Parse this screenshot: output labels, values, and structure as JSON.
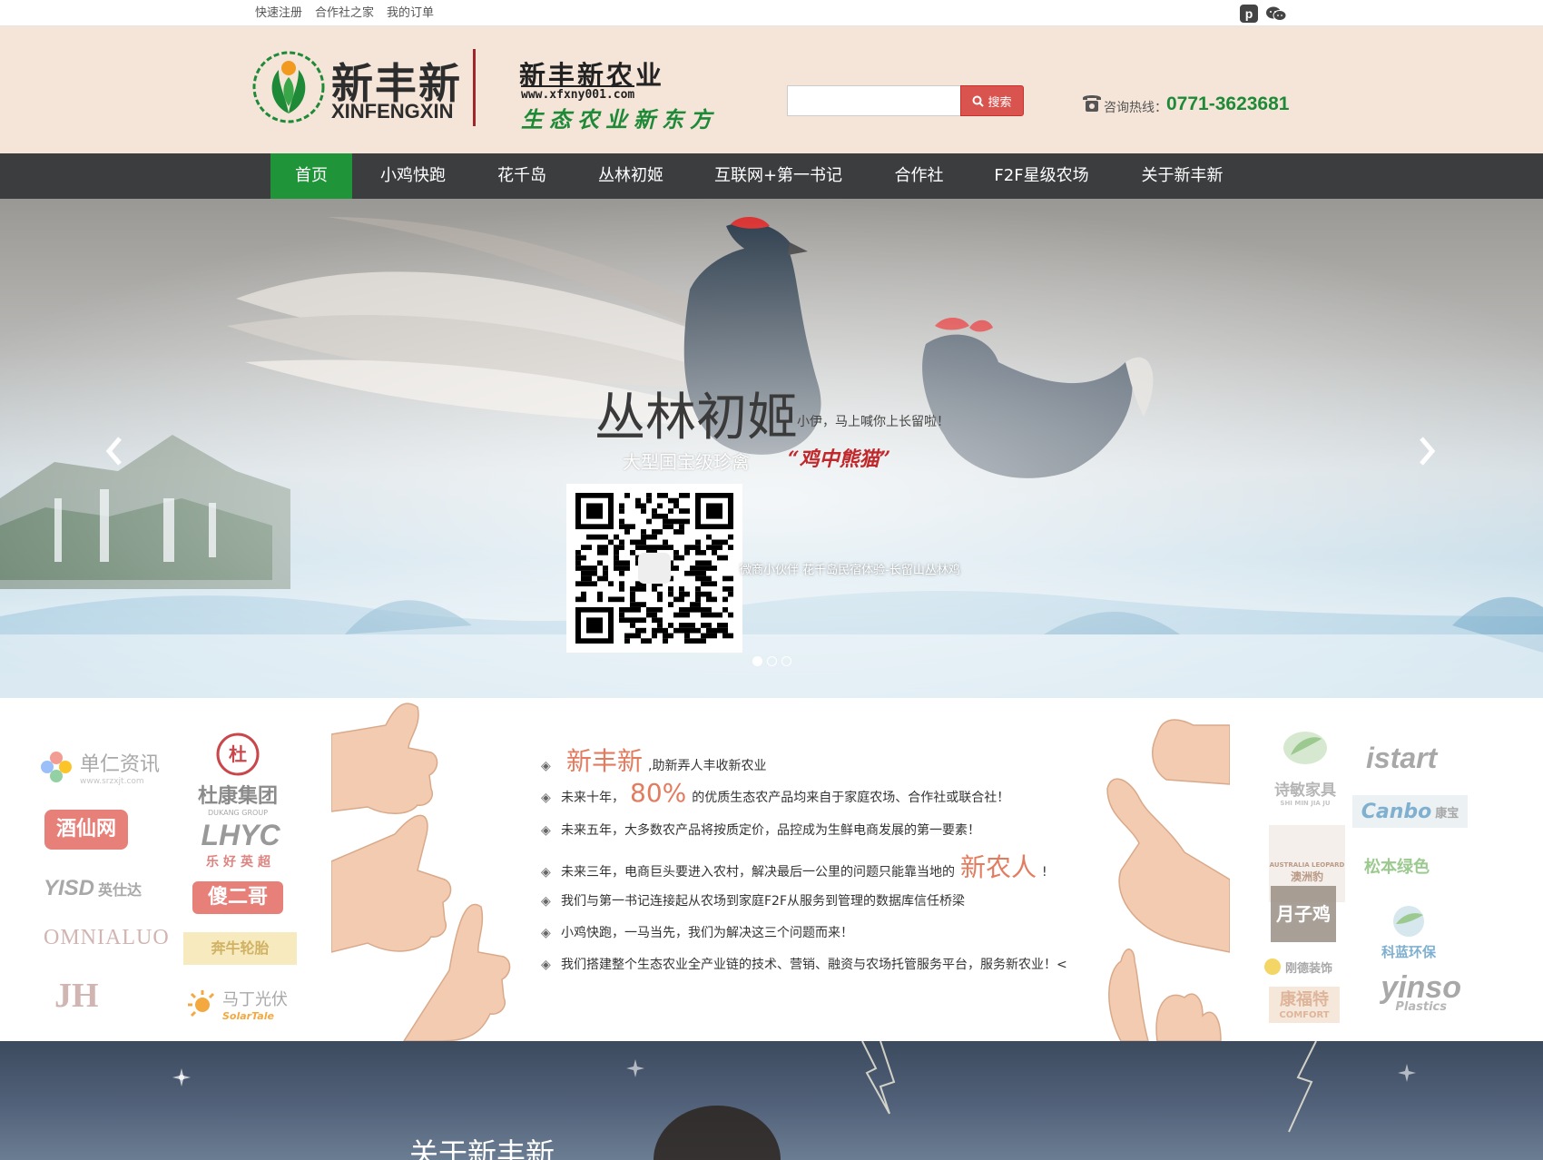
{
  "top_bar": {
    "links": [
      "快速注册",
      "合作社之家",
      "我的订单"
    ],
    "social_icons": [
      "pinterest-icon",
      "wechat-icon"
    ]
  },
  "header": {
    "logo_name": "新丰新",
    "logo_en": "XINFENGXIN",
    "brand_cn": "新丰新农业",
    "brand_url": "www.xfxny001.com",
    "brand_slogan": "生态农业新东方",
    "search": {
      "placeholder": "",
      "button_label": "搜索"
    },
    "phone_label": "咨询热线：",
    "phone_number": "0771-3623681"
  },
  "nav": {
    "items": [
      "首页",
      "小鸡快跑",
      "花千岛",
      "丛林初姬",
      "互联网+第一书记",
      "合作社",
      "F2F星级农场",
      "关于新丰新"
    ],
    "active_index": 0
  },
  "hero": {
    "title": "丛林初姬",
    "tagline": "小伊，马上喊你上长留啦！",
    "subtitle": "大型国宝级珍禽",
    "callout": "“鸡中熊猫”",
    "qr_caption": "微商小伙伴 花千岛民宿体验-长留山丛林鸡",
    "slide_dots": 3,
    "active_dot": 0
  },
  "features": {
    "lines": [
      {
        "pre": "",
        "hl": "新丰新",
        "post": ",助新弄人丰收新农业"
      },
      {
        "pre": "未来十年，",
        "hl": "80%",
        "post": "的优质生态农产品均来自于家庭农场、合作社或联合社！"
      },
      {
        "pre": "未来五年，大多数农产品将按质定价，品控成为生鲜电商发展的第一要素！",
        "hl": "",
        "post": ""
      },
      {
        "pre": "未来三年，电商巨头要进入农村，解决最后一公里的问题只能靠当地的",
        "hl": "新农人",
        "post": "!"
      },
      {
        "pre": "我们与第一书记连接起从农场到家庭F2F从服务到管理的数据库信任桥梁",
        "hl": "",
        "post": ""
      },
      {
        "pre": "小鸡快跑，一马当先，我们为解决这三个问题而来！",
        "hl": "",
        "post": ""
      },
      {
        "pre": "我们搭建整个生态农业全产业链的技术、营销、融资与农场托管服务平台，服务新农业！<",
        "hl": "",
        "post": ""
      }
    ],
    "partners_left": [
      "单仁资讯",
      "www.srzxjt.com",
      "杜康集团",
      "DUKANG GROUP",
      "酒仙网",
      "LHYC",
      "乐好英超",
      "YISD",
      "英仕达",
      "傻二哥",
      "OMNIALUO",
      "奔牛轮胎",
      "JH",
      "马丁光伏",
      "SolarTale"
    ],
    "partners_right": [
      "诗敏家具",
      "SHI MIN JIA JU",
      "istart",
      "Canbo",
      "康宝",
      "AUSTRALIA LEOPARD",
      "澳洲豹",
      "松本绿色",
      "月子鸡",
      "科蓝环保",
      "刚德装饰",
      "康福特",
      "COMFORT",
      "yinso",
      "Plastics"
    ]
  },
  "about": {
    "title": "关于新丰新"
  },
  "colors": {
    "accent_green": "#1f9439",
    "accent_red": "#d9534f",
    "nav_bg": "#3b3d3f",
    "header_bg": "#f5e5d8",
    "highlight": "#e37b5f"
  }
}
